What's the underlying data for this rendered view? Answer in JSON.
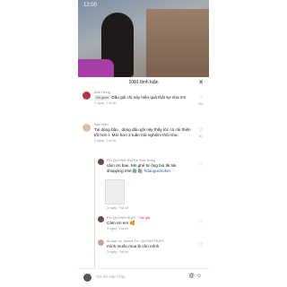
{
  "status": {
    "time": "12:00",
    "signal": ""
  },
  "header": {
    "title": "1001 bình luận"
  },
  "comments": [
    {
      "user": "Ánh Hồng",
      "badge": "Đã ghim",
      "text": "Dầu gội chị này hiệu quả thật sự nha mn",
      "date": "3 ngày",
      "reply": "Trả lời",
      "likes": "391"
    },
    {
      "user": "Bảo Hân",
      "text": "Tui dùng bầu , dùng dầu gội này thấy tóc có cải thiện tốt hơn í. Mới hơn 2 tuần trải nghiệm thôi nha.",
      "date": "2 ngày",
      "reply": "Trả lời",
      "likes": "87"
    },
    {
      "user": "Fb: QUYNH RUPI",
      "to": "Ánh Hồng",
      "text": "cảm ơn bae. Mn ghé tư ông bio tik tok shopping nhé",
      "tag": "#dauguoboket",
      "date": "3 ngày",
      "reply": "Trả lời"
    },
    {
      "user": "Fb: QUYNH RUPI",
      "author": "Tác giả",
      "text": "Cảm ơn em",
      "date": "3 ngày",
      "reply": "Trả lời"
    },
    {
      "user": "Ai huệ cô_mao",
      "to": "Fb: QUYNH RUPI",
      "text": "mình muốn mua ib cho mình",
      "date": "3 ngày",
      "reply": "Trả lời"
    }
  ],
  "input": {
    "placeholder": "Trả lời Hân Hân"
  }
}
